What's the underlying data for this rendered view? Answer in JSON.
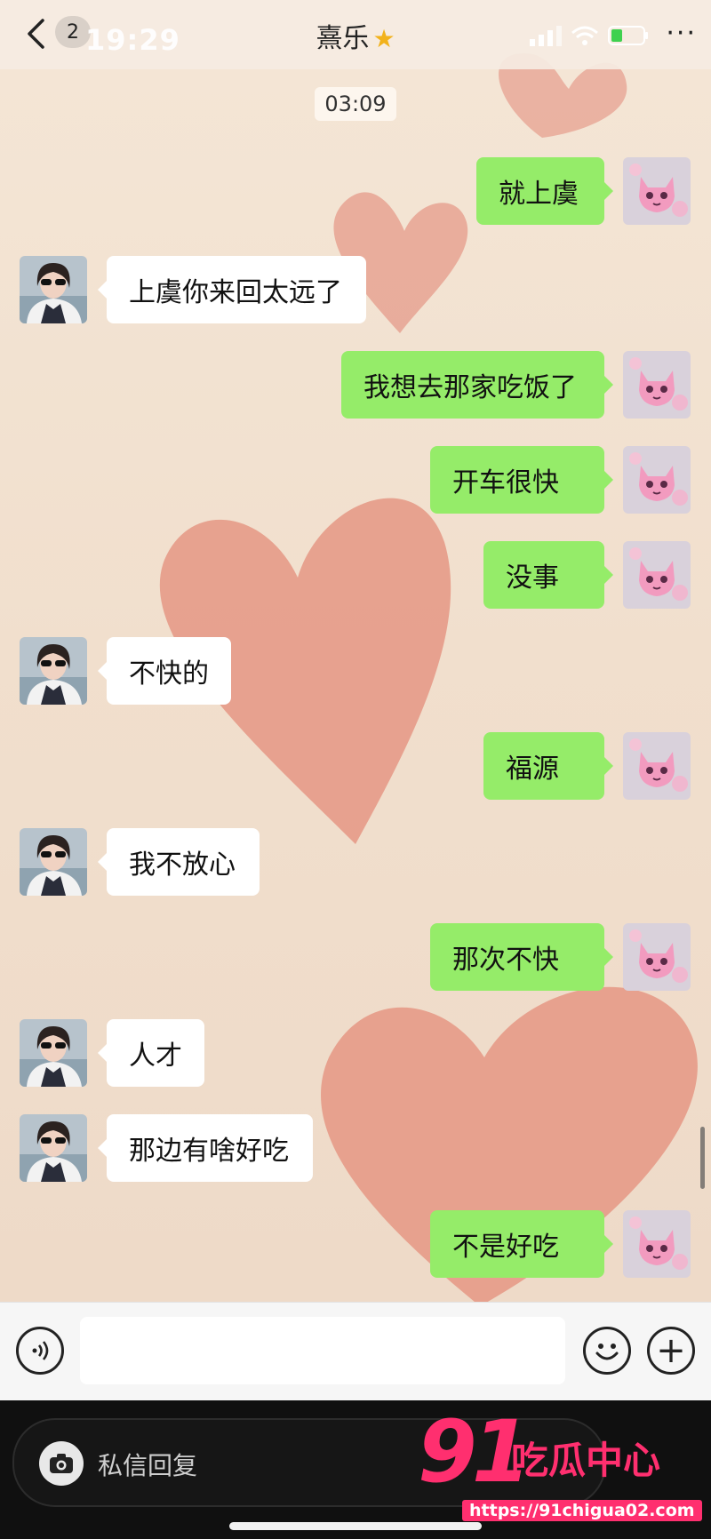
{
  "header": {
    "back_icon": "chevron-left-icon",
    "unread_count": "2",
    "status_time": "19:29",
    "title": "熹乐",
    "title_emoji": "★",
    "more_label": "···"
  },
  "time_stamp": "03:09",
  "messages": [
    {
      "side": "right",
      "text": "就上虞"
    },
    {
      "side": "left",
      "text": "上虞你来回太远了"
    },
    {
      "side": "right",
      "text": "我想去那家吃饭了"
    },
    {
      "side": "right",
      "text": "开车很快"
    },
    {
      "side": "right",
      "text": "没事"
    },
    {
      "side": "left",
      "text": "不快的"
    },
    {
      "side": "right",
      "text": "福源"
    },
    {
      "side": "left",
      "text": "我不放心"
    },
    {
      "side": "right",
      "text": "那次不快"
    },
    {
      "side": "left",
      "text": "人才"
    },
    {
      "side": "left",
      "text": "那边有啥好吃"
    },
    {
      "side": "right",
      "text": "不是好吃"
    }
  ],
  "input_bar": {
    "voice_icon": "voice-icon",
    "emoji_icon": "smile-icon",
    "plus_icon": "plus-icon",
    "plus_label": "+"
  },
  "footer": {
    "camera_icon": "camera-icon",
    "reply_placeholder": "私信回复",
    "watermark_number": "91",
    "watermark_text": "吃瓜中心",
    "watermark_url": "https://91chigua02.com"
  },
  "colors": {
    "bubble_sent": "#95ec69",
    "bubble_received": "#ffffff",
    "accent": "#ff2f6f"
  }
}
